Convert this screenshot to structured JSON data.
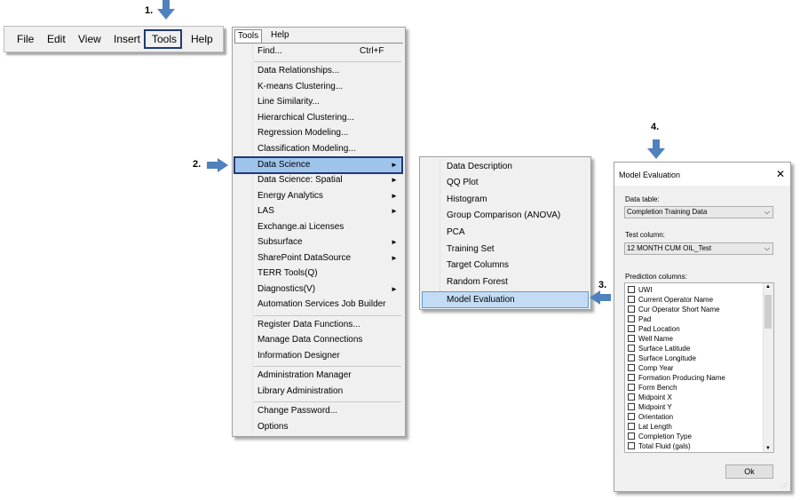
{
  "steps": {
    "step1": "1.",
    "step2": "2.",
    "step3": "3.",
    "step4": "4."
  },
  "colors": {
    "arrow": "#4f81bd",
    "highlight_border": "#1f3a73",
    "menu_highlight": "#9fc4ec",
    "submenu_highlight": "#c3dcf3"
  },
  "menubar": {
    "items": [
      "File",
      "Edit",
      "View",
      "Insert",
      "Tools",
      "Help"
    ]
  },
  "tools_menu": {
    "header_tools": "Tools",
    "header_help": "Help",
    "items": [
      {
        "label": "Find...",
        "shortcut": "Ctrl+F",
        "submenu": false
      },
      {
        "label": "Data Relationships...",
        "submenu": false
      },
      {
        "label": "K-means Clustering...",
        "submenu": false
      },
      {
        "label": "Line Similarity...",
        "submenu": false
      },
      {
        "label": "Hierarchical Clustering...",
        "submenu": false
      },
      {
        "label": "Regression Modeling...",
        "submenu": false
      },
      {
        "label": "Classification Modeling...",
        "submenu": false
      },
      {
        "label": "Data Science",
        "submenu": true,
        "highlighted": true
      },
      {
        "label": "Data Science: Spatial",
        "submenu": true
      },
      {
        "label": "Energy Analytics",
        "submenu": true
      },
      {
        "label": "LAS",
        "submenu": true
      },
      {
        "label": "Exchange.ai Licenses",
        "submenu": false
      },
      {
        "label": "Subsurface",
        "submenu": true
      },
      {
        "label": "SharePoint DataSource",
        "submenu": true
      },
      {
        "label": "TERR Tools(Q)",
        "submenu": false
      },
      {
        "label": "Diagnostics(V)",
        "submenu": true
      },
      {
        "label": "Automation Services Job Builder",
        "submenu": false
      },
      {
        "label": "Register Data Functions...",
        "submenu": false
      },
      {
        "label": "Manage Data Connections",
        "submenu": false
      },
      {
        "label": "Information Designer",
        "submenu": false
      },
      {
        "label": "Administration Manager",
        "submenu": false
      },
      {
        "label": "Library Administration",
        "submenu": false
      },
      {
        "label": "Change Password...",
        "submenu": false
      },
      {
        "label": "Options",
        "submenu": false
      }
    ],
    "submenu_arrow": "►"
  },
  "data_science_menu": {
    "items": [
      "Data Description",
      "QQ Plot",
      "Histogram",
      "Group Comparison (ANOVA)",
      "PCA",
      "Training Set",
      "Target Columns",
      "Random Forest",
      "Model Evaluation"
    ],
    "highlighted": "Model Evaluation"
  },
  "dialog": {
    "title": "Model Evaluation",
    "close_glyph": "✕",
    "data_table_label": "Data table:",
    "data_table_value": "Completion Training Data",
    "test_column_label": "Test column:",
    "test_column_value": "12 MONTH CUM OIL_Test",
    "prediction_columns_label": "Prediction columns:",
    "prediction_columns": [
      "UWI",
      "Current Operator Name",
      "Cur Operator Short Name",
      "Pad",
      "Pad Location",
      "Well Name",
      "Surface Latitude",
      "Surface Longitude",
      "Comp Year",
      "Formation Producing Name",
      "Form Bench",
      "Midpoint X",
      "Midpoint Y",
      "Orientation",
      "Lat Length",
      "Completion Type",
      "Total Fluid (gals)"
    ],
    "ok_label": "Ok",
    "dropdown_glyph": "⌵",
    "scroll_up_glyph": "▲",
    "scroll_down_glyph": "▼",
    "resize_grip_glyph": "⋰"
  }
}
